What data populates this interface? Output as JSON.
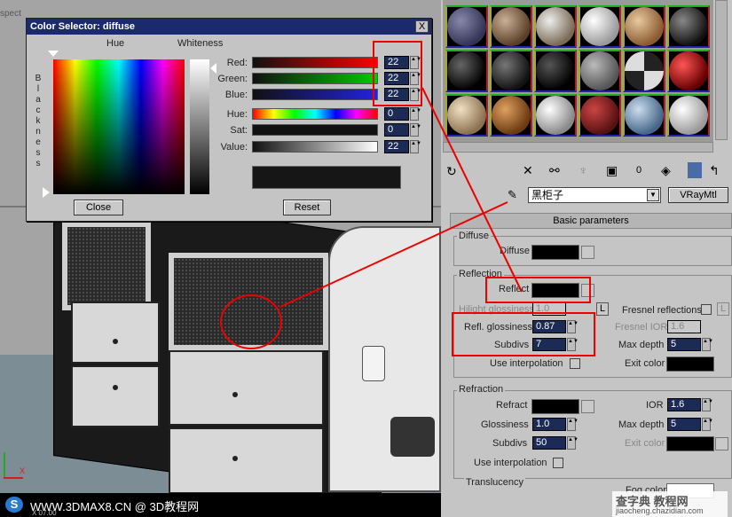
{
  "viewport": {
    "top_label": "spect",
    "axis_label": "X"
  },
  "color_selector": {
    "title": "Color Selector: diffuse",
    "close_x": "X",
    "hue_header": "Hue",
    "whiteness_header": "Whiteness",
    "blackness_letters": [
      "B",
      "l",
      "a",
      "c",
      "k",
      "n",
      "e",
      "s",
      "s"
    ],
    "rows": [
      {
        "label": "Red:",
        "value": "22"
      },
      {
        "label": "Green:",
        "value": "22"
      },
      {
        "label": "Blue:",
        "value": "22"
      },
      {
        "label": "Hue:",
        "value": "0"
      },
      {
        "label": "Sat:",
        "value": "0"
      },
      {
        "label": "Value:",
        "value": "22"
      }
    ],
    "close_button": "Close",
    "reset_button": "Reset",
    "preview_color": "#161616"
  },
  "material_editor": {
    "toolbar_item": "0",
    "material_name": "黑柜子",
    "material_type": "VRayMtl",
    "rollout_title": "Basic parameters",
    "diffuse": {
      "group": "Diffuse",
      "label": "Diffuse"
    },
    "reflection": {
      "group": "Reflection",
      "reflect_label": "Reflect",
      "hilight_label": "Hilight glossiness",
      "hilight_value": "1.0",
      "lock_label": "L",
      "fresnel_label": "Fresnel reflections",
      "fresnel_ior_label": "Fresnel IOR",
      "fresnel_ior_value": "1.6",
      "refl_gloss_label": "Refl. glossiness",
      "refl_gloss_value": "0.87",
      "max_depth_label": "Max depth",
      "max_depth_value": "5",
      "subdivs_label": "Subdivs",
      "subdivs_value": "7",
      "use_interp_label": "Use interpolation",
      "exit_color_label": "Exit color"
    },
    "refraction": {
      "group": "Refraction",
      "refract_label": "Refract",
      "ior_label": "IOR",
      "ior_value": "1.6",
      "gloss_label": "Glossiness",
      "gloss_value": "1.0",
      "max_depth_label": "Max depth",
      "max_depth_value": "5",
      "subdivs_label": "Subdivs",
      "subdivs_value": "50",
      "exit_color_label": "Exit color",
      "use_interp_label": "Use interpolation",
      "translucency_label": "Translucency",
      "fog_color_label": "Fog color"
    }
  },
  "watermark": {
    "left_text": "WWW.3DMAX8.CN @ 3D教程网",
    "right_text": "查字典 教程网",
    "right_url": "jiaocheng.chazidian.com",
    "bottom_left": "X 07.00"
  },
  "colors": {
    "annotation_red": "#e00000",
    "title_blue": "#1a2a6c",
    "spinner_bg": "#1c2b55"
  }
}
